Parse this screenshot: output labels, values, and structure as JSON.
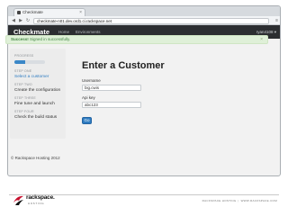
{
  "browser": {
    "tab_title": "Checkmate",
    "tab_close": "×",
    "url": "checkmate-n01.dev.ord1.ci.rackspace.net",
    "back": "◀",
    "forward": "▶",
    "reload": "↻",
    "menu": "≡"
  },
  "app": {
    "brand": "Checkmate",
    "nav": [
      "Home",
      "Environments"
    ],
    "user": "ryan4108 ▾"
  },
  "alert": {
    "strong": "Success!",
    "text": " Signed in successfully.",
    "close": "×"
  },
  "sidebar": {
    "progress_label": "PROGRESS",
    "progress_fraction": 0.35,
    "steps": [
      {
        "label": "STEP ONE",
        "title": "Select a customer",
        "active": true
      },
      {
        "label": "STEP TWO",
        "title": "Create the configuration",
        "active": false
      },
      {
        "label": "STEP THREE",
        "title": "Fine tune and launch",
        "active": false
      },
      {
        "label": "STEP FOUR",
        "title": "Check the build status",
        "active": false
      }
    ]
  },
  "main": {
    "title": "Enter a Customer",
    "username_label": "Username",
    "username_value": "big.cwis",
    "apikey_label": "Api key",
    "apikey_value": "abc123",
    "go_label": "Go"
  },
  "page_footer": "© Rackspace Hosting 2012",
  "slide": {
    "logo_word": "rackspace.",
    "logo_sub": "HOSTING",
    "footer_left": "RACKSPACE HOSTING",
    "footer_sep": "|",
    "footer_right": "WWW.RACKSPACE.COM"
  },
  "colors": {
    "accent": "#2f7cc1",
    "navbar": "#2c2e31",
    "alert_bg": "#dff0d8",
    "alert_text": "#468847",
    "logo_red": "#c8102e"
  }
}
